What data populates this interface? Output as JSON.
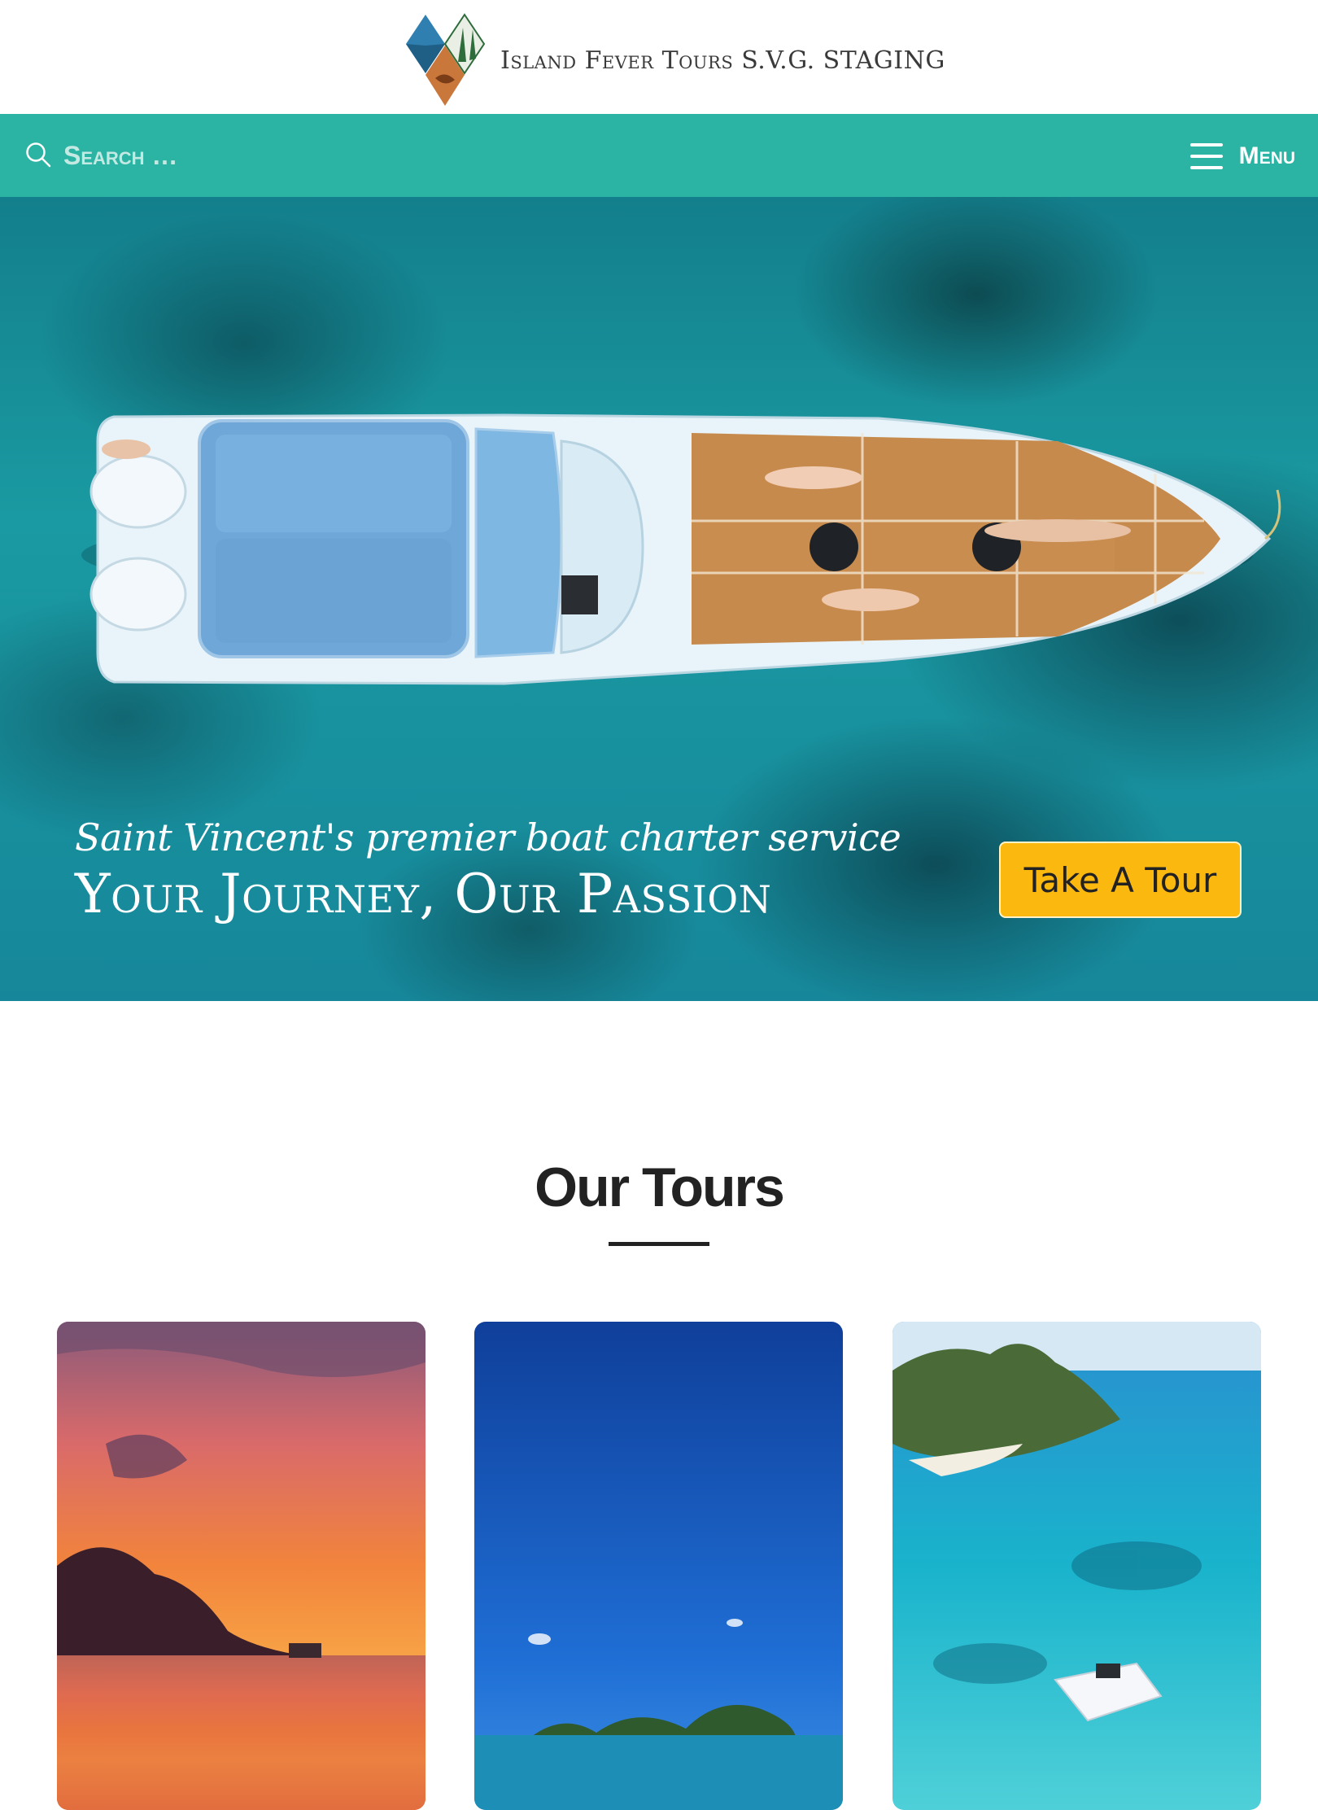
{
  "header": {
    "site_title": "Island Fever Tours S.V.G. STAGING",
    "logo_icon": "diamond-island-logo"
  },
  "nav": {
    "search_placeholder": "Search …",
    "menu_label": "Menu",
    "search_icon": "search-icon",
    "menu_icon": "hamburger-icon",
    "accent_color": "#2bb4a3"
  },
  "hero": {
    "tagline": "Saint Vincent's premier boat charter service",
    "title": "Your Journey, Our Passion",
    "cta_label": "Take A Tour",
    "cta_color": "#fbb80f"
  },
  "tours": {
    "heading": "Our Tours",
    "cards": [
      {
        "image": "sunset-over-island-photo"
      },
      {
        "image": "blue-sky-island-photo"
      },
      {
        "image": "turquoise-bay-boat-photo"
      }
    ]
  }
}
